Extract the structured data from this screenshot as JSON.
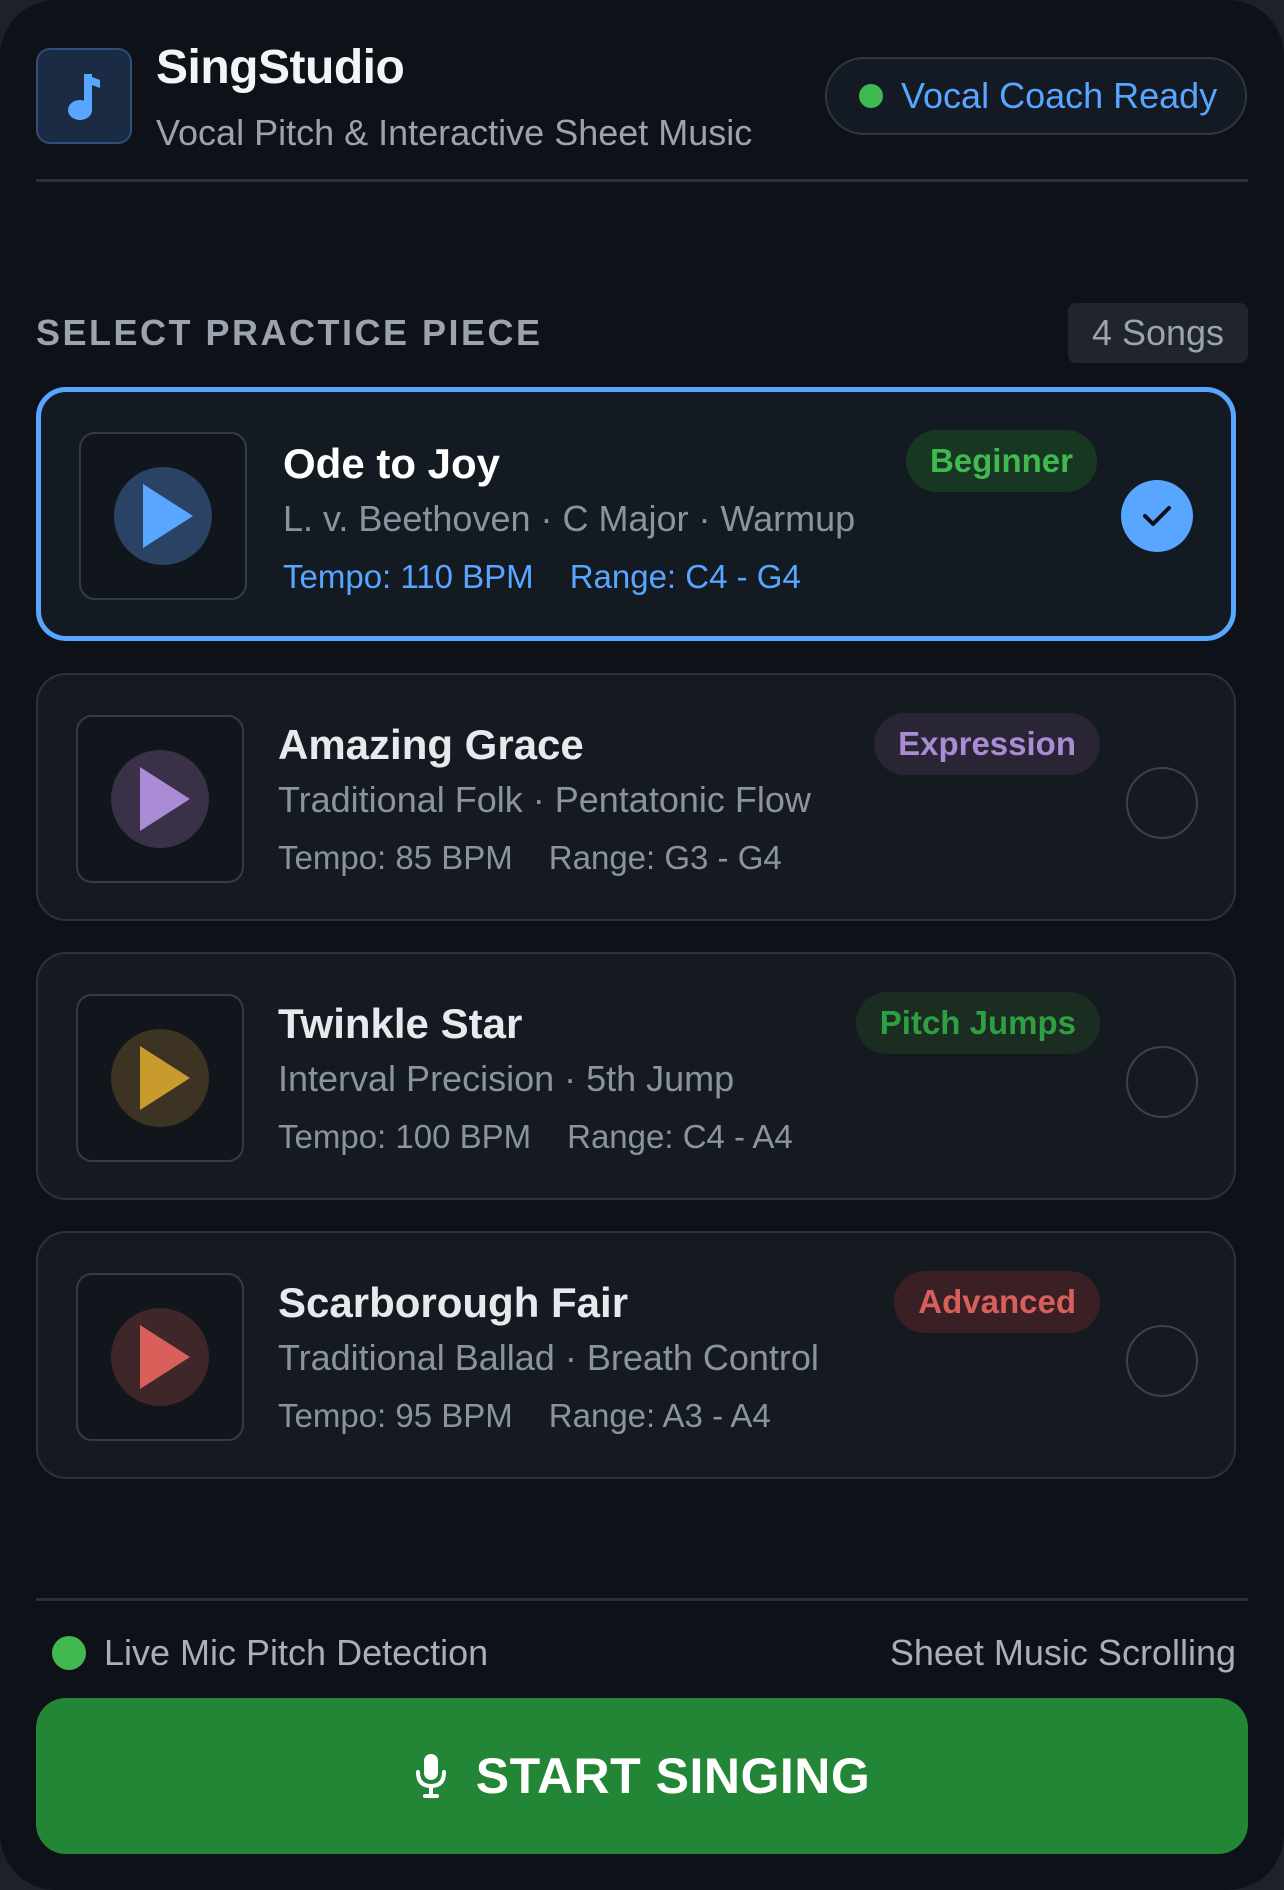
{
  "header": {
    "app_title": "SingStudio",
    "subtitle": "Vocal Pitch & Interactive Sheet Music",
    "logo_icon": "music-note-icon",
    "status_label": "Vocal Coach Ready",
    "status_color": "#3fb950"
  },
  "section": {
    "title": "SELECT PRACTICE PIECE",
    "count_label": "4 Songs"
  },
  "songs": [
    {
      "title": "Ode to Joy",
      "meta": "L. v. Beethoven · C Major · Warmup",
      "tempo": "Tempo: 110 BPM",
      "range": "Range: C4 - G4",
      "tag": "Beginner",
      "tag_color": "#3fb950",
      "accent": "#58a6ff",
      "selected": true
    },
    {
      "title": "Amazing Grace",
      "meta": "Traditional Folk · Pentatonic Flow",
      "tempo": "Tempo: 85 BPM",
      "range": "Range: G3 - G4",
      "tag": "Expression",
      "tag_color": "#a98bd6",
      "accent": "#a98bd6",
      "selected": false
    },
    {
      "title": "Twinkle Star",
      "meta": "Interval Precision · 5th Jump",
      "tempo": "Tempo: 100 BPM",
      "range": "Range: C4 - A4",
      "tag": "Pitch Jumps",
      "tag_color": "#2ea043",
      "accent": "#c99a2e",
      "selected": false
    },
    {
      "title": "Scarborough Fair",
      "meta": "Traditional Ballad · Breath Control",
      "tempo": "Tempo: 95 BPM",
      "range": "Range: A3 - A4",
      "tag": "Advanced",
      "tag_color": "#d9605a",
      "accent": "#d9605a",
      "selected": false
    }
  ],
  "footer": {
    "feature_left": "Live Mic Pitch Detection",
    "feature_right": "Sheet Music Scrolling",
    "start_label": "START SINGING",
    "start_icon": "microphone-icon",
    "button_color": "#238636"
  }
}
